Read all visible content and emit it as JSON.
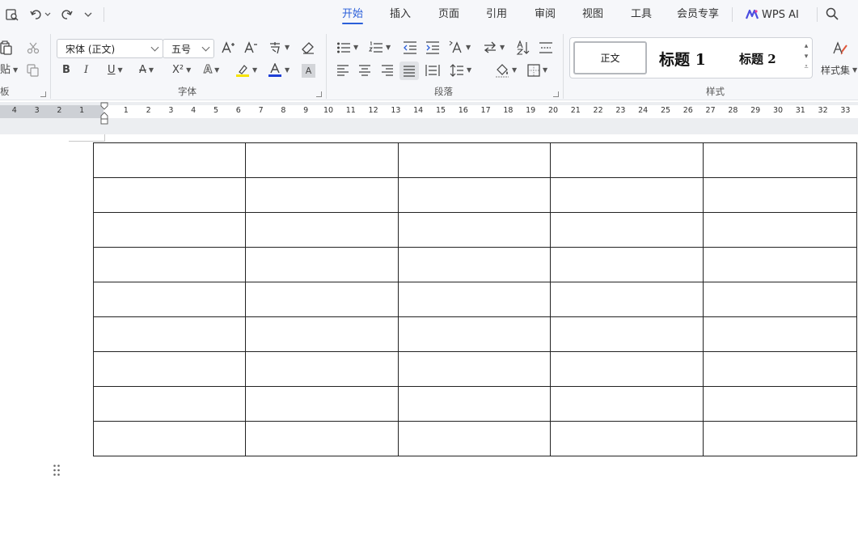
{
  "menu": {
    "tabs": [
      {
        "label": "开始",
        "active": true
      },
      {
        "label": "插入"
      },
      {
        "label": "页面"
      },
      {
        "label": "引用"
      },
      {
        "label": "审阅"
      },
      {
        "label": "视图"
      },
      {
        "label": "工具"
      },
      {
        "label": "会员专享"
      }
    ],
    "ai_label": "WPS AI",
    "accent": "#2b5fd9"
  },
  "ribbon": {
    "clipboard": {
      "paste_label": "贴",
      "group_label": "板"
    },
    "font": {
      "font_name": "宋体 (正文)",
      "font_size": "五号",
      "group_label": "字体",
      "bold": "B",
      "italic": "I",
      "underline": "U",
      "strike": "A",
      "superscript": "X²",
      "text_effect": "A",
      "font_color": "A",
      "char_shading": "A",
      "grow": "A⁺",
      "shrink": "A⁻",
      "pinyin": "ㄅ",
      "highlight_color": "#f7e300",
      "font_color_value": "#1f3fd6"
    },
    "paragraph": {
      "group_label": "段落"
    },
    "styles": {
      "normal": "正文",
      "heading1": "标题 1",
      "heading2": "标题 2",
      "gallery_label": "样式集",
      "group_label": "样式"
    }
  },
  "ruler": {
    "left_numbers": [
      "4",
      "3",
      "2",
      "1"
    ],
    "right_numbers": [
      "1",
      "2",
      "3",
      "4",
      "5",
      "6",
      "7",
      "8",
      "9",
      "10",
      "11",
      "12",
      "13",
      "14",
      "15",
      "16",
      "17",
      "18",
      "19",
      "20",
      "21",
      "22",
      "23",
      "24",
      "25",
      "26",
      "27",
      "28",
      "29",
      "30",
      "31",
      "32",
      "33"
    ]
  },
  "document": {
    "table": {
      "rows": 9,
      "columns": 5
    }
  }
}
